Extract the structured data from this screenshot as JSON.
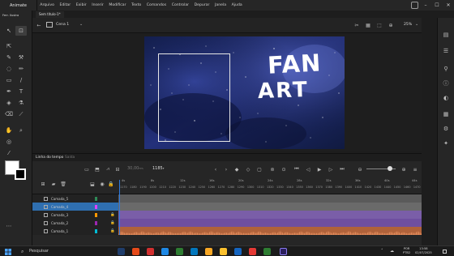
{
  "menubar": {
    "app_name": "Animate",
    "items": [
      "Arquivo",
      "Editar",
      "Exibir",
      "Inserir",
      "Modificar",
      "Texto",
      "Comandos",
      "Controlar",
      "Depurar",
      "Janela",
      "Ajuda"
    ]
  },
  "toolbar": {
    "title": "Ferr. Ilustra"
  },
  "doc_tab": {
    "label": "Sem título-1*"
  },
  "scene": {
    "label": "Cena 1",
    "zoom": "25%"
  },
  "stage": {
    "title_line1": "FAN",
    "title_line2": "ART",
    "background_color": "#1a2455"
  },
  "timeline": {
    "tabs": {
      "timeline": "Linha do tempo",
      "output": "Saída"
    },
    "fps": "30,00",
    "fps_unit": "FPS",
    "current_frame": "1185",
    "frame_unit": "F",
    "ruler_seconds": [
      "4s",
      "8s",
      "12s",
      "16s",
      "20s",
      "24s",
      "28s",
      "32s",
      "36s",
      "40s",
      "44s"
    ],
    "ruler_frames": [
      "1170",
      "1180",
      "1190",
      "1200",
      "1210",
      "1220",
      "1230",
      "1240",
      "1250",
      "1260",
      "1270",
      "1280",
      "1290",
      "1300",
      "1310",
      "1320",
      "1330",
      "1340",
      "1350",
      "1360",
      "1370",
      "1380",
      "1390",
      "1400",
      "1410",
      "1420",
      "1430",
      "1440",
      "1450",
      "1460",
      "1470"
    ],
    "layers": [
      {
        "name": "Camada_5",
        "color": "#2e8b57",
        "active": false
      },
      {
        "name": "Camada_4",
        "color": "#e040fb",
        "active": true
      },
      {
        "name": "Camada_3",
        "color": "#ff9800",
        "active": false
      },
      {
        "name": "Camada_2",
        "color": "#9c27b0",
        "active": false
      },
      {
        "name": "Camada_1",
        "color": "#00bcd4",
        "active": false
      }
    ]
  },
  "taskbar": {
    "search_label": "Pesquisar",
    "lang_line1": "POR",
    "lang_line2": "PTB2",
    "time": "13:58",
    "date": "02/07/2025"
  }
}
